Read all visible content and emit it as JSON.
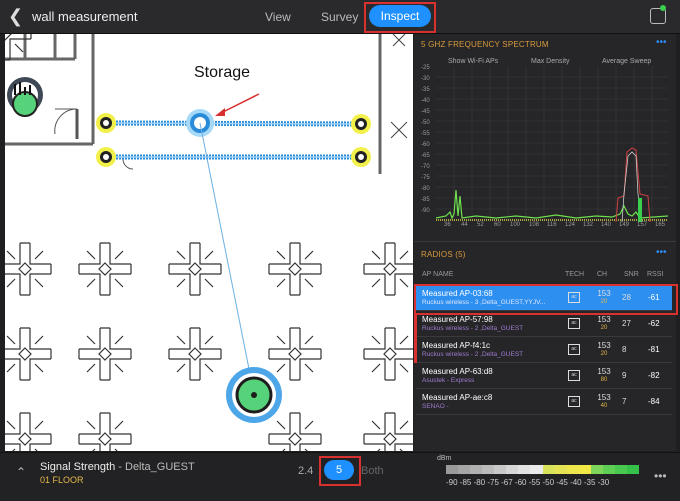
{
  "header": {
    "title": "wall measurement",
    "tabs": [
      {
        "label": "View"
      },
      {
        "label": "Survey"
      },
      {
        "label": "Inspect"
      }
    ]
  },
  "map": {
    "room_label": "Storage"
  },
  "spectrum": {
    "title": "5 GHZ FREQUENCY SPECTRUM",
    "options": [
      "Show Wi-Fi APs",
      "Max Density",
      "Average Sweep"
    ],
    "chart_data": {
      "type": "line",
      "y_ticks": [
        "-25",
        "-30",
        "-35",
        "-40",
        "-45",
        "-50",
        "-55",
        "-60",
        "-65",
        "-70",
        "-75",
        "-80",
        "-85",
        "-90"
      ],
      "x_ticks": [
        "36",
        "44",
        "52",
        "60",
        "100",
        "108",
        "116",
        "124",
        "132",
        "140",
        "149",
        "157",
        "165"
      ]
    }
  },
  "radios": {
    "title": "RADIOS (5)",
    "columns": [
      "AP NAME",
      "TECH",
      "CH",
      "SNR",
      "RSSI"
    ],
    "rows": [
      {
        "name": "Measured AP-03:68",
        "sub": "Ruckus wireless - 3 ,Delta_GUEST,YYJV...",
        "tech": "ac",
        "ch": "153",
        "ch_sub": "20",
        "snr": "28",
        "rssi": "-61"
      },
      {
        "name": "Measured AP-57:98",
        "sub": "Ruckus wireless - 2 ,Delta_GUEST",
        "tech": "ac",
        "ch": "153",
        "ch_sub": "20",
        "snr": "27",
        "rssi": "-62"
      },
      {
        "name": "Measured AP-f4:1c",
        "sub": "Ruckus wireless - 2 ,Delta_GUEST",
        "tech": "ac",
        "ch": "153",
        "ch_sub": "20",
        "snr": "8",
        "rssi": "-81"
      },
      {
        "name": "Measured AP-63:d8",
        "sub": "Asustek - Express",
        "tech": "ac",
        "ch": "153",
        "ch_sub": "80",
        "snr": "9",
        "rssi": "-82"
      },
      {
        "name": "Measured AP-ae:c8",
        "sub": "SENAO -",
        "tech": "ac",
        "ch": "153",
        "ch_sub": "40",
        "snr": "7",
        "rssi": "-84"
      }
    ]
  },
  "footer": {
    "metric": "Signal Strength",
    "network": " - Delta_GUEST",
    "floor": "01 FLOOR",
    "band_24": "2.4",
    "band_5": "5",
    "band_both": "Both",
    "unit": "dBm",
    "scale_labels": "-90 -85 -80 -75  -67  -60 -55 -50 -45 -40 -35 -30"
  },
  "colors": {
    "accent": "#1e90ff",
    "highlight_box": "#d93030",
    "spectrum_green": "#3ccf4e",
    "section_title": "#d89a3c"
  }
}
